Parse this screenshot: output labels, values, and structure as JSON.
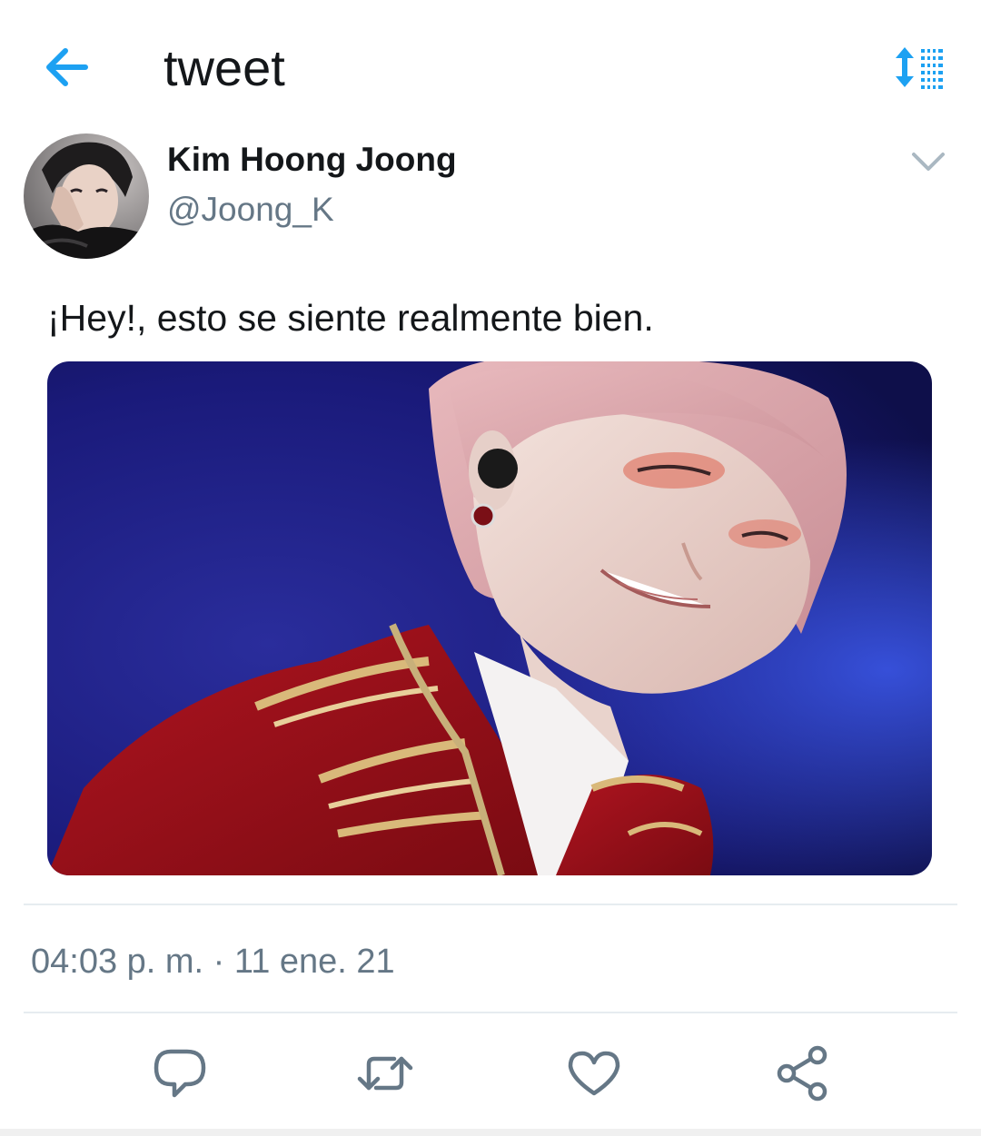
{
  "header": {
    "title": "tweet",
    "back_icon": "arrow-left-icon",
    "sort_icon": "sort-list-icon",
    "accent_color": "#1da1f2"
  },
  "author": {
    "display_name": "Kim Hoong Joong",
    "handle": "@Joong_K",
    "avatar_icon": "avatar-photo",
    "more_icon": "chevron-down-icon"
  },
  "tweet": {
    "text": "¡Hey!, esto se siente realmente bien.",
    "media_description_icon": "photo",
    "timestamp": "04:03 p. m. · 11 ene. 21"
  },
  "actions": {
    "reply_icon": "reply-bubble-icon",
    "retweet_icon": "retweet-icon",
    "like_icon": "heart-icon",
    "share_icon": "share-icon",
    "icon_color": "#657786"
  }
}
